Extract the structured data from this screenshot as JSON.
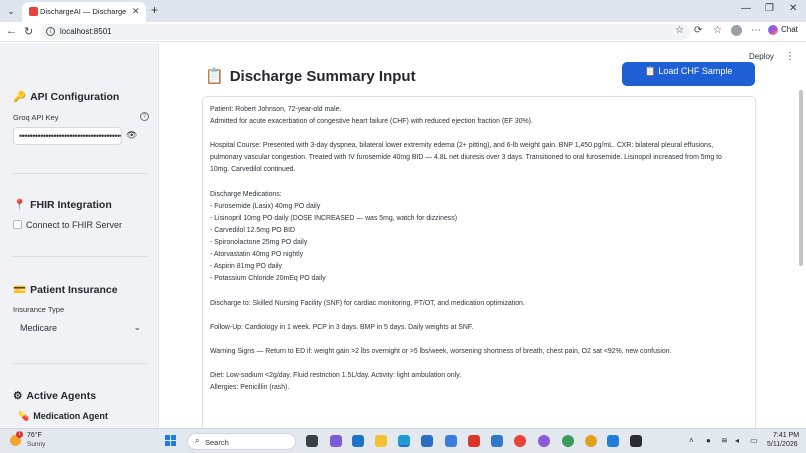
{
  "browser": {
    "tab_title": "DischargeAI — Discharge Planning",
    "url": "localhost:8501",
    "chat_label": "Chat"
  },
  "app": {
    "deploy_label": "Deploy",
    "menu_icon": "more-vertical-icon"
  },
  "sidebar": {
    "api_section": {
      "icon": "🔑",
      "title": "API Configuration"
    },
    "api_key_label": "Groq API Key",
    "api_key_masked": "•••••••••••••••••••••••••••••••••••••••",
    "fhir_section": {
      "icon": "📍",
      "title": "FHIR Integration"
    },
    "fhir_checkbox_label": "Connect to FHIR Server",
    "insurance_section": {
      "icon": "💳",
      "title": "Patient Insurance"
    },
    "insurance_type_label": "Insurance Type",
    "insurance_type_value": "Medicare",
    "agents_section": {
      "icon": "⚙",
      "title": "Active Agents"
    },
    "medication_agent": {
      "icon": "💊",
      "label": "Medication Agent"
    }
  },
  "main": {
    "title_icon": "📋",
    "title": "Discharge Summary Input",
    "load_button_icon": "📋",
    "load_button_label": "Load CHF Sample",
    "summary_lines": [
      "Patient: Robert Johnson, 72-year-old male.",
      "Admitted for acute exacerbation of congestive heart failure (CHF) with reduced ejection fraction (EF 30%).",
      "",
      "Hospital Course: Presented with 3-day dyspnea, bilateral lower extremity edema (2+ pitting), and 6-lb weight gain. BNP 1,450 pg/mL. CXR: bilateral pleural effusions,",
      "pulmonary vascular congestion. Treated with IV furosemide 40mg BID — 4.8L net diuresis over 3 days. Transitioned to oral furosemide. Lisinopril increased from 5mg to",
      "10mg. Carvedilol continued.",
      "",
      "Discharge Medications:",
      "- Furosemide (Lasix) 40mg PO daily",
      "- Lisinopril 10mg PO daily (DOSE INCREASED — was 5mg, watch for dizziness)",
      "- Carvedilol 12.5mg PO BID",
      "- Spironolactone 25mg PO daily",
      "- Atorvastatin 40mg PO nightly",
      "- Aspirin 81mg PO daily",
      "- Potassium Chloride 20mEq PO daily",
      "",
      "Discharge to: Skilled Nursing Facility (SNF) for cardiac monitoring, PT/OT, and medication optimization.",
      "",
      "Follow-Up: Cardiology in 1 week. PCP in 3 days. BMP in 5 days. Daily weights at SNF.",
      "",
      "Warning Signs — Return to ED if: weight gain >2 lbs overnight or >5 lbs/week, worsening shortness of breath, chest pain, O2 sat <92%, new confusion.",
      "",
      "Diet: Low-sodium <2g/day. Fluid restriction 1.5L/day. Activity: light ambulation only.",
      "Allergies: Penicillin (rash)."
    ]
  },
  "taskbar": {
    "temperature": "76°F",
    "condition": "Sunny",
    "notification_count": "1",
    "search_label": "Search",
    "time": "7:41 PM",
    "date": "5/11/2026"
  }
}
